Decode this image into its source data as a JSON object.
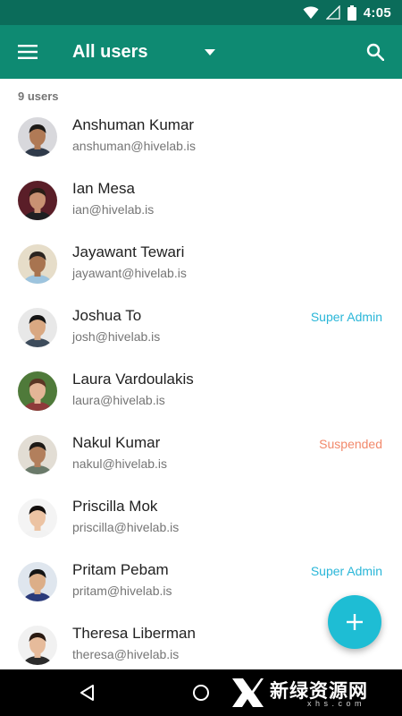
{
  "status_bar": {
    "time": "4:05"
  },
  "app_bar": {
    "title": "All users"
  },
  "list": {
    "count_label": "9 users",
    "users": [
      {
        "name": "Anshuman Kumar",
        "email": "anshuman@hivelab.is",
        "role": "",
        "role_color": "",
        "skin": "#b07a56",
        "hair": "#1d1a18",
        "bg": "#d8d8dc",
        "shirt": "#2f3a4a"
      },
      {
        "name": "Ian Mesa",
        "email": "ian@hivelab.is",
        "role": "",
        "role_color": "",
        "skin": "#c99273",
        "hair": "#2a1d16",
        "bg": "#5a1e28",
        "shirt": "#1f1f22"
      },
      {
        "name": "Jayawant Tewari",
        "email": "jayawant@hivelab.is",
        "role": "",
        "role_color": "",
        "skin": "#a87450",
        "hair": "#2b2420",
        "bg": "#e6ddc9",
        "shirt": "#9dc4de"
      },
      {
        "name": "Joshua To",
        "email": "josh@hivelab.is",
        "role": "Super Admin",
        "role_color": "#29b6d8",
        "skin": "#d9a882",
        "hair": "#151515",
        "bg": "#e8e8e8",
        "shirt": "#3d4c5c"
      },
      {
        "name": "Laura Vardoulakis",
        "email": "laura@hivelab.is",
        "role": "",
        "role_color": "",
        "skin": "#e3b597",
        "hair": "#5a3524",
        "bg": "#4f7a3a",
        "shirt": "#8e3a3a"
      },
      {
        "name": "Nakul Kumar",
        "email": "nakul@hivelab.is",
        "role": "Suspended",
        "role_color": "#f2896b",
        "skin": "#b27f5c",
        "hair": "#1e1a17",
        "bg": "#e2ddd4",
        "shirt": "#6a7a6a"
      },
      {
        "name": "Priscilla Mok",
        "email": "priscilla@hivelab.is",
        "role": "",
        "role_color": "",
        "skin": "#ecc3a3",
        "hair": "#120e0c",
        "bg": "#f4f4f4",
        "shirt": "#f2f2f2"
      },
      {
        "name": "Pritam Pebam",
        "email": "pritam@hivelab.is",
        "role": "Super Admin",
        "role_color": "#29b6d8",
        "skin": "#dcae88",
        "hair": "#141414",
        "bg": "#dfe6ee",
        "shirt": "#2a3a7a"
      },
      {
        "name": "Theresa Liberman",
        "email": "theresa@hivelab.is",
        "role": "",
        "role_color": "",
        "skin": "#e6bb9b",
        "hair": "#2a1a12",
        "bg": "#f1f1f1",
        "shirt": "#2b2b2b"
      }
    ]
  },
  "watermark": {
    "text": "新绿资源网",
    "sub": "x h s . c o m"
  },
  "colors": {
    "status_bar": "#0b6c5a",
    "app_bar": "#0e8a72",
    "fab": "#1ebdd4",
    "super_admin": "#29b6d8",
    "suspended": "#f2896b"
  },
  "icons": {
    "menu": "hamburger-menu-icon",
    "dropdown": "triangle-down-icon",
    "search": "search-icon",
    "fab": "plus-icon",
    "nav_back": "triangle-back-icon",
    "nav_home": "circle-home-icon",
    "wifi": "wifi-icon",
    "signal": "signal-icon",
    "battery": "battery-icon"
  }
}
